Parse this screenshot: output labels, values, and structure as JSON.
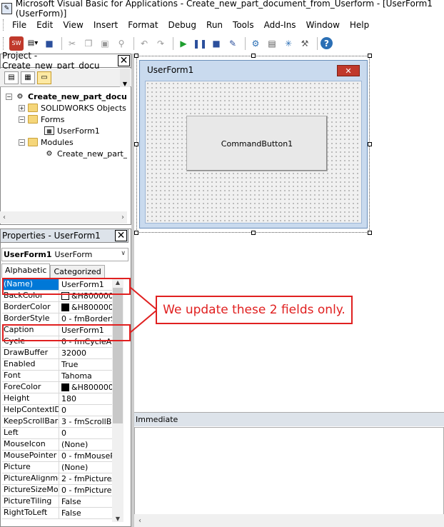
{
  "window": {
    "title": "Microsoft Visual Basic for Applications - Create_new_part_document_from_Userform - [UserForm1 (UserForm)]"
  },
  "menu": [
    "File",
    "Edit",
    "View",
    "Insert",
    "Format",
    "Debug",
    "Run",
    "Tools",
    "Add-Ins",
    "Window",
    "Help"
  ],
  "project": {
    "title": "Project - Create_new_part_docu",
    "nodes": [
      {
        "label": "Create_new_part_docu"
      },
      {
        "label": "SOLIDWORKS Objects"
      },
      {
        "label": "Forms"
      },
      {
        "label": "UserForm1"
      },
      {
        "label": "Modules"
      },
      {
        "label": "Create_new_part_d"
      }
    ]
  },
  "properties": {
    "title": "Properties - UserForm1",
    "object_name": "UserForm1",
    "object_type": "UserForm",
    "tabs": [
      "Alphabetic",
      "Categorized"
    ],
    "rows": [
      {
        "name": "(Name)",
        "value": "UserForm1"
      },
      {
        "name": "BackColor",
        "value": "&H800000",
        "swatch": "#ffffff"
      },
      {
        "name": "BorderColor",
        "value": "&H800000",
        "swatch": "#000000"
      },
      {
        "name": "BorderStyle",
        "value": "0 - fmBorderSt"
      },
      {
        "name": "Caption",
        "value": "UserForm1"
      },
      {
        "name": "Cycle",
        "value": "0 - fmCycleAllF"
      },
      {
        "name": "DrawBuffer",
        "value": "32000"
      },
      {
        "name": "Enabled",
        "value": "True"
      },
      {
        "name": "Font",
        "value": "Tahoma"
      },
      {
        "name": "ForeColor",
        "value": "&H800000",
        "swatch": "#000000"
      },
      {
        "name": "Height",
        "value": "180"
      },
      {
        "name": "HelpContextID",
        "value": "0"
      },
      {
        "name": "KeepScrollBarsV",
        "value": "3 - fmScrollBar"
      },
      {
        "name": "Left",
        "value": "0"
      },
      {
        "name": "MouseIcon",
        "value": "(None)"
      },
      {
        "name": "MousePointer",
        "value": "0 - fmMousePo"
      },
      {
        "name": "Picture",
        "value": "(None)"
      },
      {
        "name": "PictureAlignmen",
        "value": "2 - fmPictureAl"
      },
      {
        "name": "PictureSizeMode",
        "value": "0 - fmPictureSi"
      },
      {
        "name": "PictureTiling",
        "value": "False"
      },
      {
        "name": "RightToLeft",
        "value": "False"
      }
    ]
  },
  "userform": {
    "title": "UserForm1",
    "button_label": "CommandButton1"
  },
  "immediate": {
    "title": "Immediate"
  },
  "annotation": {
    "text": "We update these 2 fields only.",
    "color": "#e02020"
  }
}
